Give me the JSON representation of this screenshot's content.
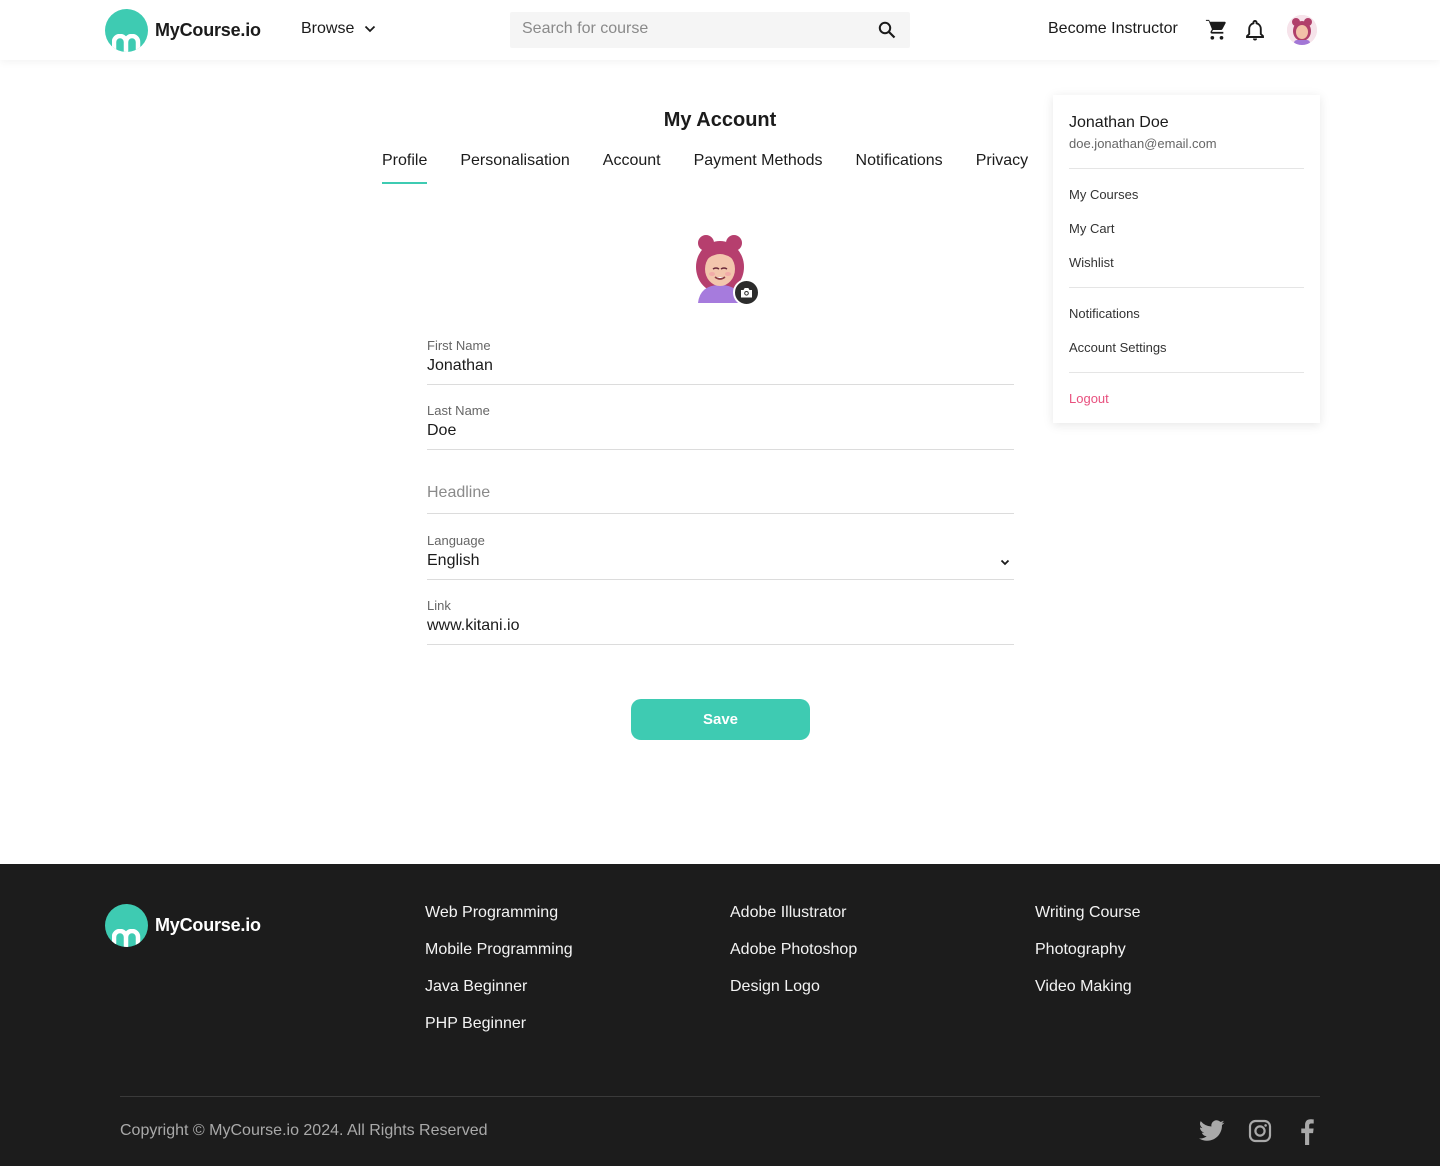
{
  "brand": {
    "name": "MyCourse.io",
    "accent": "#3ecbb2",
    "logout_color": "#e8507e"
  },
  "header": {
    "browse_label": "Browse",
    "search_placeholder": "Search for course",
    "become_instructor": "Become Instructor",
    "icons": [
      "search-icon",
      "cart-icon",
      "bell-icon",
      "avatar"
    ]
  },
  "main": {
    "title": "My Account",
    "tabs": [
      {
        "label": "Profile",
        "active": true
      },
      {
        "label": "Personalisation"
      },
      {
        "label": "Account"
      },
      {
        "label": "Payment Methods"
      },
      {
        "label": "Notifications"
      },
      {
        "label": "Privacy"
      }
    ],
    "form": {
      "first_name": {
        "label": "First Name",
        "value": "Jonathan"
      },
      "last_name": {
        "label": "Last Name",
        "value": "Doe"
      },
      "headline": {
        "placeholder": "Headline"
      },
      "language": {
        "label": "Language",
        "value": "English"
      },
      "link": {
        "label": "Link",
        "value": "www.kitani.io"
      }
    },
    "save_label": "Save"
  },
  "dropdown": {
    "name": "Jonathan Doe",
    "email": "doe.jonathan@email.com",
    "group1": [
      "My Courses",
      "My Cart",
      "Wishlist"
    ],
    "group2": [
      "Notifications",
      "Account Settings"
    ],
    "logout": "Logout"
  },
  "footer": {
    "col1": [
      "Web Programming",
      "Mobile Programming",
      "Java Beginner",
      "PHP Beginner"
    ],
    "col2": [
      "Adobe Illustrator",
      "Adobe Photoshop",
      "Design Logo"
    ],
    "col3": [
      "Writing Course",
      "Photography",
      "Video Making"
    ],
    "copyright": "Copyright © MyCourse.io 2024. All Rights Reserved",
    "social": [
      "twitter-icon",
      "instagram-icon",
      "facebook-icon"
    ]
  }
}
